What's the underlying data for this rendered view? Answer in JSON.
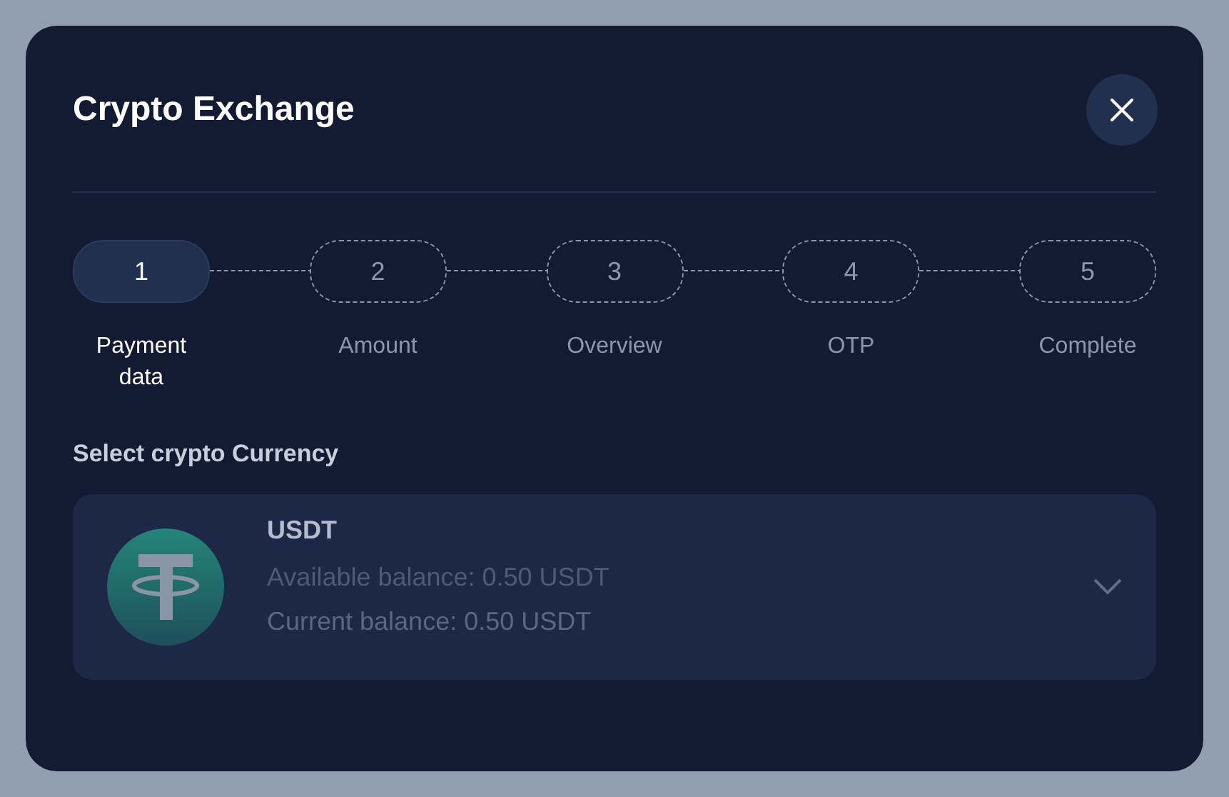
{
  "dialog": {
    "title": "Crypto Exchange"
  },
  "steps": [
    {
      "number": "1",
      "label": "Payment data",
      "selected": true
    },
    {
      "number": "2",
      "label": "Amount",
      "selected": false
    },
    {
      "number": "3",
      "label": "Overview",
      "selected": false
    },
    {
      "number": "4",
      "label": "OTP",
      "selected": false
    },
    {
      "number": "5",
      "label": "Complete",
      "selected": false
    }
  ],
  "currency_section": {
    "label": "Select crypto Currency",
    "selected_currency": {
      "name": "USDT",
      "available_balance": "Available balance: 0.50 USDT",
      "current_balance": "Current balance: 0.50 USDT"
    }
  }
}
